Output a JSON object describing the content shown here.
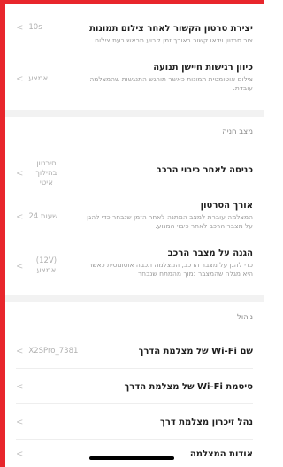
{
  "colors": {
    "frame": "#e8262c",
    "text": "#1f1f1f",
    "muted": "#9a9a9a",
    "value": "#b0b0b0"
  },
  "video_section": {
    "items": [
      {
        "title": "יצירת סרטון הקשור לאחר צילום תמונות",
        "desc": "צור סרטון וידאו קשור באורך זמן קבוע מראש בעת צילום",
        "value": "10s"
      },
      {
        "title": "כיוון רגישות חיישן תנועה",
        "desc": "צילום אוטומטית תמונות כאשר תורגש התנגשות שהמצלמה עובדת.",
        "value": "אמצע"
      }
    ]
  },
  "parking_section": {
    "header": "מצב חניה",
    "items": [
      {
        "title": "כניסה לאחר כיבוי הרכב",
        "desc": "",
        "value": "סירטון בהילוך איטי"
      },
      {
        "title": "אורך הסרטון",
        "desc": "המצלמה עוברת למצב המתנה לאחר הזמן שנבחר כדי להגן על מצבר הרכב לאחר כיבוי המנוע.",
        "value": "24 שעות"
      },
      {
        "title": "הגנה על מצבר הרכב",
        "desc": "כדי להגן על מצבר הרכב, המצלמה תכבה אוטומטית כאשר היא מגלה שהמצבר נמוך מהמתח שנבחר",
        "value": "(12V) אמצע"
      }
    ]
  },
  "management_section": {
    "header": "ניהול",
    "items": [
      {
        "title": "שם Wi-Fi של מצלמת הדרך",
        "value": "X2SPro_7381"
      },
      {
        "title": "סיסמת Wi-Fi של מצלמת הדרך",
        "value": ""
      },
      {
        "title": "נהל זיכרון מצלמת דרך",
        "value": ""
      },
      {
        "title": "אודות המצלמה",
        "value": ""
      }
    ]
  },
  "icons": {
    "chevron": "chevron-left-icon"
  }
}
